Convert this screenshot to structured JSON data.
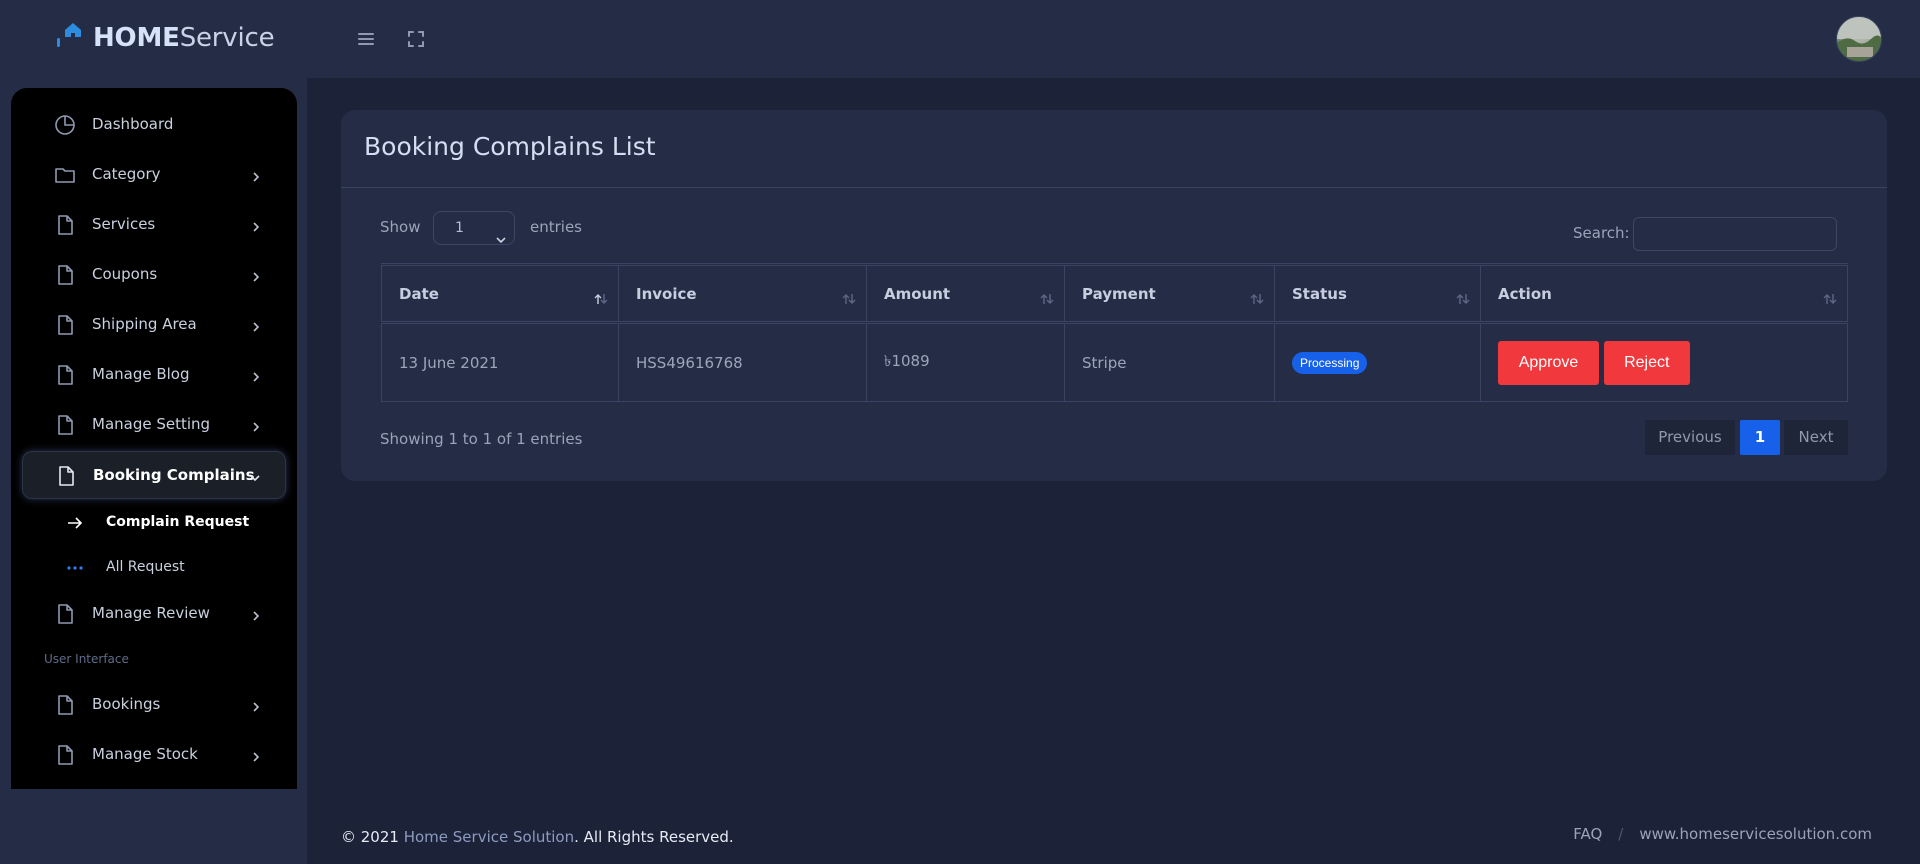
{
  "brand": {
    "bold": "HOME",
    "rest": "Service"
  },
  "colors": {
    "accent": "#1761ea",
    "danger": "#f0383d",
    "logo_blue": "#2c8de0",
    "bg": "#1c2238",
    "panel": "#252d46",
    "sidebar": "#000000"
  },
  "topbar": {
    "menu_icon": "hamburger-icon",
    "fullscreen_icon": "fullscreen-icon",
    "avatar": "user-avatar"
  },
  "sidebar": {
    "items": [
      {
        "label": "Dashboard",
        "icon": "pie-chart-icon"
      },
      {
        "label": "Category",
        "icon": "folder-icon"
      },
      {
        "label": "Services",
        "icon": "file-icon"
      },
      {
        "label": "Coupons",
        "icon": "file-icon"
      },
      {
        "label": "Shipping Area",
        "icon": "file-icon"
      },
      {
        "label": "Manage Blog",
        "icon": "file-icon"
      },
      {
        "label": "Manage Setting",
        "icon": "file-icon"
      },
      {
        "label": "Booking Complains",
        "icon": "file-icon",
        "active": true
      },
      {
        "label": "Manage Review",
        "icon": "file-icon"
      },
      {
        "label": "Bookings",
        "icon": "file-icon"
      },
      {
        "label": "Manage Stock",
        "icon": "file-icon"
      }
    ],
    "subitems": [
      {
        "label": "Complain Request",
        "icon": "arrow-right-icon",
        "active": true
      },
      {
        "label": "All Request",
        "icon": "dots-icon"
      }
    ],
    "section_label": "User Interface"
  },
  "card": {
    "title": "Booking Complains List",
    "show_label": "Show",
    "entries_label": "entries",
    "page_length": "1",
    "search_label": "Search:",
    "search_value": ""
  },
  "table": {
    "headers": [
      "Date",
      "Invoice",
      "Amount",
      "Payment",
      "Status",
      "Action"
    ],
    "rows": [
      {
        "date": "13 June 2021",
        "invoice": "HSS49616768",
        "amount": "৳1089",
        "payment": "Stripe",
        "status": "Processing",
        "approve": "Approve",
        "reject": "Reject"
      }
    ]
  },
  "pagination": {
    "info": "Showing 1 to 1 of 1 entries",
    "previous": "Previous",
    "current": "1",
    "next": "Next"
  },
  "footer": {
    "copyright_prefix": "© 2021 ",
    "brand_link": "Home Service Solution",
    "copyright_suffix": ". All Rights Reserved.",
    "faq": "FAQ",
    "separator": "/",
    "website": "www.homeservicesolution.com"
  }
}
